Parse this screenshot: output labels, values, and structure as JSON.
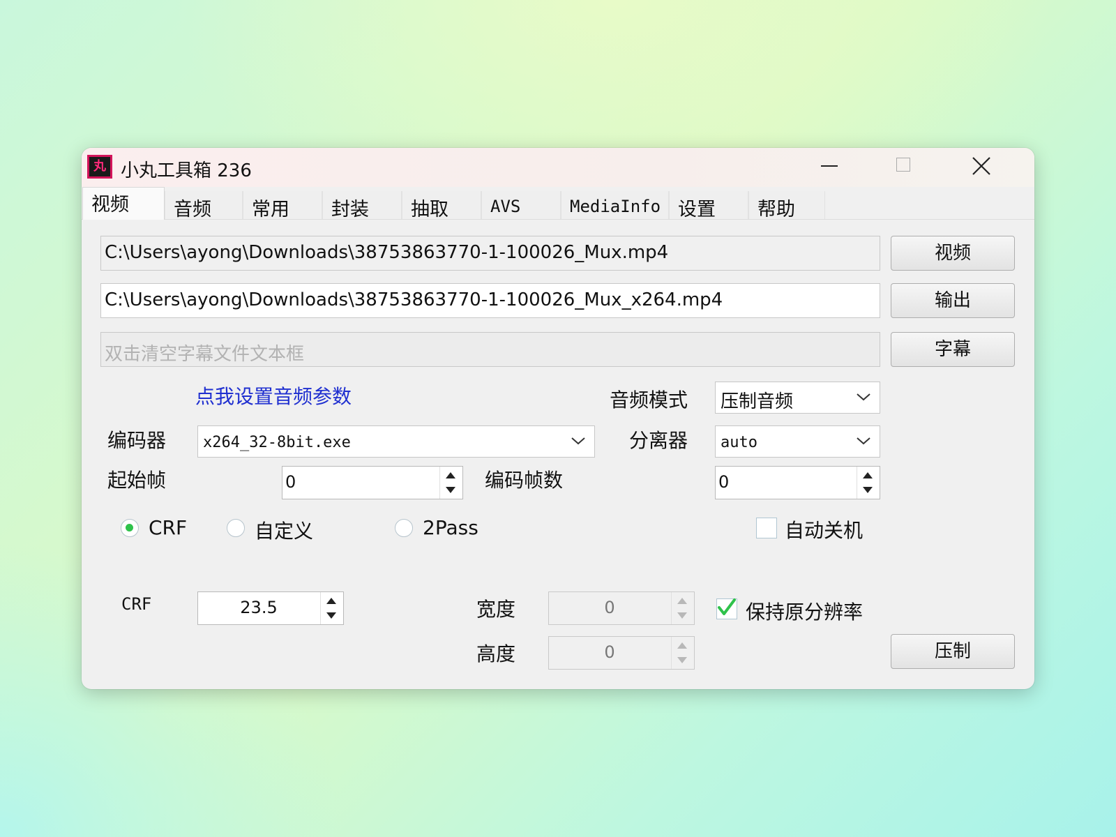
{
  "window": {
    "title": "小丸工具箱 236",
    "app_icon_glyph": "丸"
  },
  "tabs": [
    "视频",
    "音频",
    "常用",
    "封装",
    "抽取",
    "AVS",
    "MediaInfo",
    "设置",
    "帮助"
  ],
  "files": {
    "video_path": "C:\\Users\\ayong\\Downloads\\38753863770-1-100026_Mux.mp4",
    "output_path": "C:\\Users\\ayong\\Downloads\\38753863770-1-100026_Mux_x264.mp4",
    "subtitle_placeholder": "双击清空字幕文件文本框"
  },
  "buttons": {
    "video": "视频",
    "output": "输出",
    "subtitle": "字幕",
    "encode": "压制"
  },
  "audio": {
    "settings_link": "点我设置音频参数",
    "mode_label": "音频模式",
    "mode_value": "压制音频"
  },
  "encoder": {
    "label": "编码器",
    "value": "x264_32-8bit.exe"
  },
  "demuxer": {
    "label": "分离器",
    "value": "auto"
  },
  "start_frame": {
    "label": "起始帧",
    "value": "0"
  },
  "frame_count": {
    "label": "编码帧数",
    "value": "0"
  },
  "rate_mode": {
    "options": [
      "CRF",
      "自定义",
      "2Pass"
    ],
    "selected": "CRF"
  },
  "auto_shutdown": {
    "label": "自动关机",
    "checked": false
  },
  "crf": {
    "label": "CRF",
    "value": "23.5"
  },
  "width": {
    "label": "宽度",
    "value": "0"
  },
  "height": {
    "label": "高度",
    "value": "0"
  },
  "keep_resolution": {
    "label": "保持原分辨率",
    "checked": true
  },
  "colors": {
    "accent_green": "#2fc24b",
    "link_blue": "#1f2fd0",
    "icon_magenta": "#d3145a"
  }
}
